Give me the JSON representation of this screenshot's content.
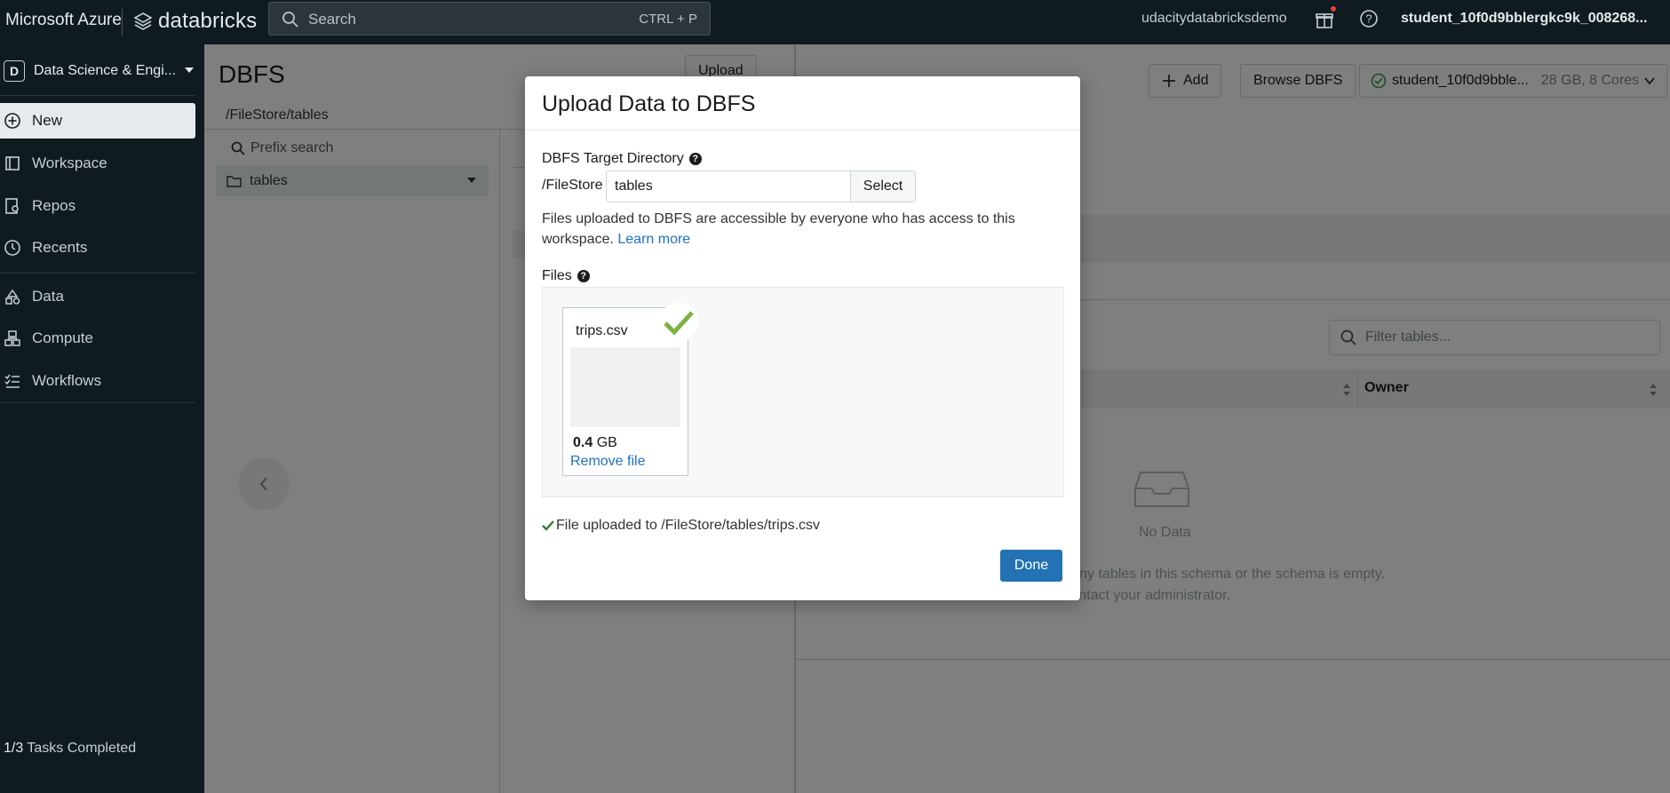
{
  "topbar": {
    "brand": "Microsoft Azure",
    "product": "databricks",
    "search_placeholder": "Search",
    "search_shortcut": "CTRL + P",
    "workspace": "udacitydatabricksdemo",
    "user": "student_10f0d9bblergkc9k_008268..."
  },
  "sidebar": {
    "persona_badge": "D",
    "persona": "Data Science & Engi...",
    "items": [
      {
        "label": "New",
        "icon": "plus-circle-icon",
        "active": true
      },
      {
        "label": "Workspace",
        "icon": "workspace-icon"
      },
      {
        "label": "Repos",
        "icon": "repos-icon"
      },
      {
        "label": "Recents",
        "icon": "clock-icon"
      },
      {
        "label": "Data",
        "icon": "data-icon"
      },
      {
        "label": "Compute",
        "icon": "compute-icon"
      },
      {
        "label": "Workflows",
        "icon": "workflows-icon"
      }
    ],
    "tasks_count": "1/3",
    "tasks_label": "Tasks Completed"
  },
  "dbfs": {
    "title": "DBFS",
    "upload_label": "Upload",
    "path": "/FileStore/tables",
    "prefix_placeholder": "Prefix search",
    "folder": "tables"
  },
  "right_panel": {
    "add_label": "Add",
    "browse_label": "Browse DBFS",
    "cluster_name": "student_10f0d9bble...",
    "cluster_spec": "28 GB, 8 Cores",
    "filter_placeholder": "Filter tables...",
    "owner_header": "Owner",
    "no_data": "No Data",
    "msg_line1": "s to any tables in this schema or the schema is empty.",
    "msg_line2": "se contact your administrator."
  },
  "modal": {
    "title": "Upload Data to DBFS",
    "target_label": "DBFS Target Directory",
    "prefix": "/FileStore",
    "target_value": "tables",
    "select_label": "Select",
    "note": "Files uploaded to DBFS are accessible by everyone who has access to this workspace.",
    "learn_more": "Learn more",
    "files_label": "Files",
    "file": {
      "name": "trips.csv",
      "size_value": "0.4",
      "size_unit": "GB",
      "remove_label": "Remove file"
    },
    "uploaded_message": "File uploaded to /FileStore/tables/trips.csv",
    "done_label": "Done"
  },
  "colors": {
    "topbar_bg": "#0f1a21",
    "primary_button": "#2272b4",
    "link": "#1f72c8",
    "success": "#7cb342"
  }
}
